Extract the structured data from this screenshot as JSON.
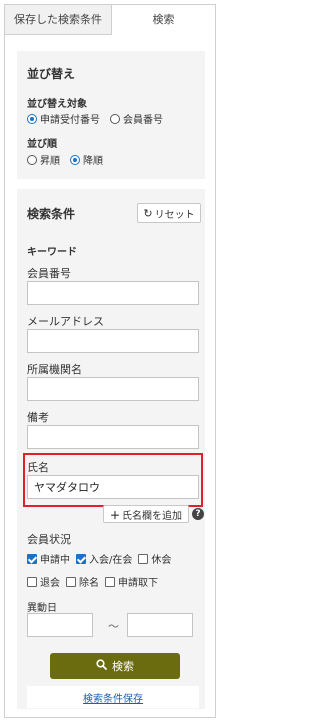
{
  "tabs": {
    "saved_label": "保存した検索条件",
    "search_label": "検索"
  },
  "sort": {
    "title": "並び替え",
    "target_label": "並び替え対象",
    "target_options": [
      {
        "label": "申請受付番号",
        "selected": true
      },
      {
        "label": "会員番号",
        "selected": false
      }
    ],
    "order_label": "並び順",
    "order_options": [
      {
        "label": "昇順",
        "selected": false
      },
      {
        "label": "降順",
        "selected": true
      }
    ]
  },
  "conditions": {
    "title": "検索条件",
    "reset_label": "リセット",
    "keyword_label": "キーワード",
    "fields": {
      "member_number": {
        "label": "会員番号",
        "value": ""
      },
      "email": {
        "label": "メールアドレス",
        "value": ""
      },
      "organization": {
        "label": "所属機関名",
        "value": ""
      },
      "notes": {
        "label": "備考",
        "value": ""
      },
      "name": {
        "label": "氏名",
        "value": "ヤマダタロウ"
      }
    },
    "add_name_label": "氏名欄を追加",
    "help_glyph": "?",
    "status_label": "会員状況",
    "status_options": [
      {
        "label": "申請中",
        "checked": true
      },
      {
        "label": "入会/在会",
        "checked": true
      },
      {
        "label": "休会",
        "checked": false
      },
      {
        "label": "退会",
        "checked": false
      },
      {
        "label": "除名",
        "checked": false
      },
      {
        "label": "申請取下",
        "checked": false
      }
    ],
    "change_date_label": "異動日",
    "date_from": "",
    "date_to": "",
    "date_separator": "～",
    "search_button_label": "検索",
    "save_link_label": "検索条件保存"
  },
  "colors": {
    "search_button": "#6b6b10",
    "highlight_border": "#e0202a",
    "accent": "#1a73c8",
    "panel_bg": "#f4f4f4"
  }
}
